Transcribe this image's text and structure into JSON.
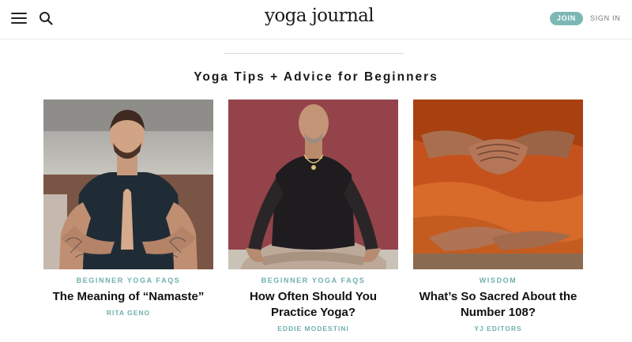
{
  "header": {
    "logo_text": "yoga journal",
    "join_label": "JOIN",
    "signin_label": "SIGN IN",
    "icons": {
      "menu": "hamburger-menu-icon",
      "search": "search-icon"
    },
    "colors": {
      "accent": "#7cb7b5"
    }
  },
  "section": {
    "title": "Yoga Tips + Advice for Beginners"
  },
  "cards": [
    {
      "category": "BEGINNER YOGA FAQS",
      "title": "The Meaning of “Namaste”",
      "author": "RITA GENO"
    },
    {
      "category": "BEGINNER YOGA FAQS",
      "title": "How Often Should You Practice Yoga?",
      "author": "EDDIE MODESTINI"
    },
    {
      "category": "WISDOM",
      "title": "What’s So Sacred About the Number 108?",
      "author": "YJ EDITORS"
    }
  ]
}
